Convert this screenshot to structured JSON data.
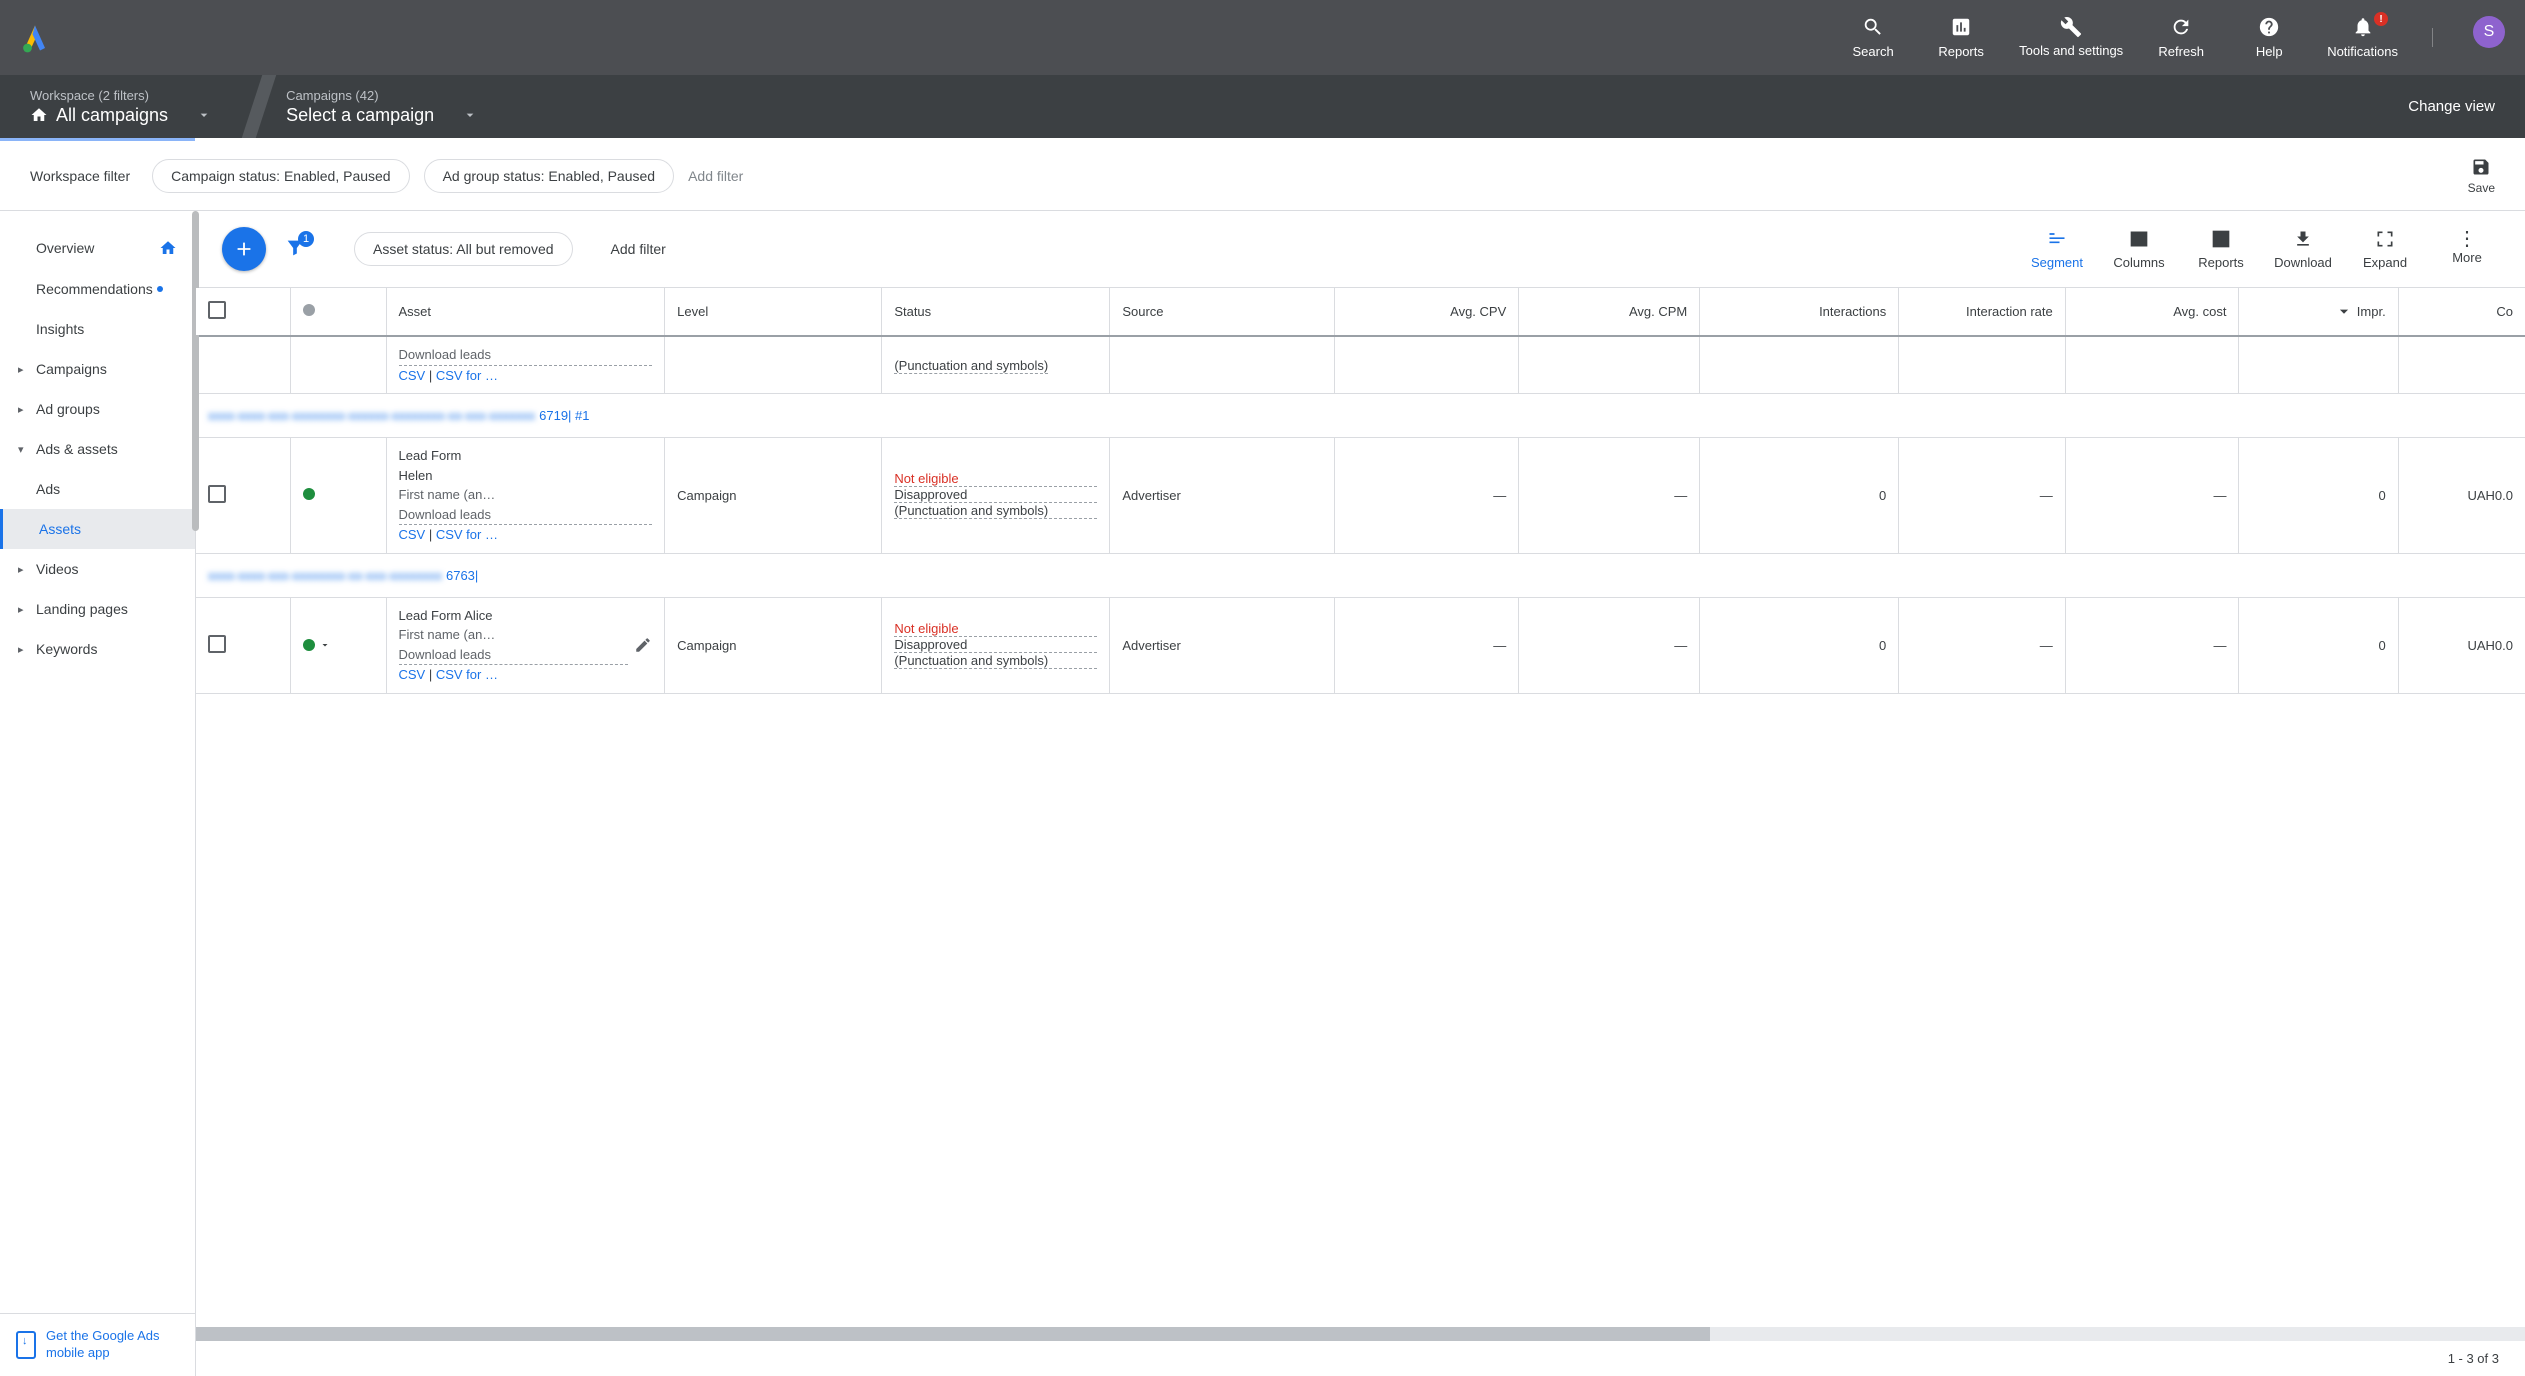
{
  "header": {
    "tools": [
      {
        "id": "search",
        "label": "Search",
        "icon": "search-icon"
      },
      {
        "id": "reports",
        "label": "Reports",
        "icon": "reports-icon"
      },
      {
        "id": "tools",
        "label": "Tools and settings",
        "icon": "tools-icon"
      },
      {
        "id": "refresh",
        "label": "Refresh",
        "icon": "refresh-icon"
      },
      {
        "id": "help",
        "label": "Help",
        "icon": "help-icon"
      },
      {
        "id": "notifications",
        "label": "Notifications",
        "icon": "bell-icon"
      }
    ],
    "notification_badge": "!",
    "avatar_initial": "S"
  },
  "breadcrumb": {
    "workspace_small": "Workspace (2 filters)",
    "workspace_big": "All campaigns",
    "campaigns_small": "Campaigns (42)",
    "campaigns_big": "Select a campaign",
    "change_view": "Change view"
  },
  "filter_bar": {
    "label": "Workspace filter",
    "chips": [
      "Campaign status: Enabled, Paused",
      "Ad group status: Enabled, Paused"
    ],
    "add_filter": "Add filter",
    "save": "Save"
  },
  "sidebar": {
    "items": [
      {
        "label": "Overview",
        "type": "top",
        "has_home": true
      },
      {
        "label": "Recommendations",
        "type": "top",
        "has_dot": true
      },
      {
        "label": "Insights",
        "type": "top"
      },
      {
        "label": "Campaigns",
        "type": "arrow"
      },
      {
        "label": "Ad groups",
        "type": "arrow"
      },
      {
        "label": "Ads & assets",
        "type": "expanded"
      },
      {
        "label": "Ads",
        "type": "sub"
      },
      {
        "label": "Assets",
        "type": "sub",
        "selected": true
      },
      {
        "label": "Videos",
        "type": "arrow"
      },
      {
        "label": "Landing pages",
        "type": "arrow"
      },
      {
        "label": "Keywords",
        "type": "arrow"
      }
    ],
    "mobile_app": "Get the Google Ads mobile app"
  },
  "toolbar": {
    "filter_count": "1",
    "asset_chip": "Asset status: All but removed",
    "add_filter": "Add filter",
    "tools": [
      {
        "label": "Segment",
        "active": true,
        "icon": "segment-icon"
      },
      {
        "label": "Columns",
        "icon": "columns-icon"
      },
      {
        "label": "Reports",
        "icon": "reports-box-icon"
      },
      {
        "label": "Download",
        "icon": "download-icon"
      },
      {
        "label": "Expand",
        "icon": "expand-icon"
      },
      {
        "label": "More",
        "icon": "more-icon"
      }
    ]
  },
  "table": {
    "headers": {
      "asset": "Asset",
      "level": "Level",
      "status": "Status",
      "source": "Source",
      "avg_cpv": "Avg. CPV",
      "avg_cpm": "Avg. CPM",
      "interactions": "Interactions",
      "interaction_rate": "Interaction rate",
      "avg_cost": "Avg. cost",
      "impr": "Impr.",
      "cost": "Co"
    },
    "partial_row": {
      "download": "Download leads",
      "csv": "CSV",
      "csv_for": "CSV for …",
      "status_detail": "(Punctuation and symbols)"
    },
    "group1": {
      "ref_blur": "xxxx-xxxx-xxx-xxxxxxxx-xxxxxx-xxxxxxxx-xx-xxx-xxxxxxx",
      "suffix": "6719| #1"
    },
    "row1": {
      "title": "Lead Form",
      "name": "Helen",
      "fields": "First name (an…",
      "download": "Download leads",
      "csv": "CSV",
      "csv_for": "CSV for …",
      "level": "Campaign",
      "status_top": "Not eligible",
      "status_det1": "Disapproved",
      "status_det2": "(Punctuation and symbols)",
      "source": "Advertiser",
      "cpv": "—",
      "cpm": "—",
      "inter": "0",
      "irate": "—",
      "avgcost": "—",
      "impr": "0",
      "cost": "UAH0.0"
    },
    "group2": {
      "ref_blur": "xxxx-xxxx-xxx-xxxxxxxx-xx-xxx-xxxxxxxx",
      "suffix": "6763|"
    },
    "row2": {
      "title": "Lead Form Alice",
      "fields": "First name (an…",
      "download": "Download leads",
      "csv": "CSV",
      "csv_for": "CSV for …",
      "level": "Campaign",
      "status_top": "Not eligible",
      "status_det1": "Disapproved",
      "status_det2": "(Punctuation and symbols)",
      "source": "Advertiser",
      "cpv": "—",
      "cpm": "—",
      "inter": "0",
      "irate": "—",
      "avgcost": "—",
      "impr": "0",
      "cost": "UAH0.0"
    }
  },
  "pager": "1 - 3 of 3"
}
